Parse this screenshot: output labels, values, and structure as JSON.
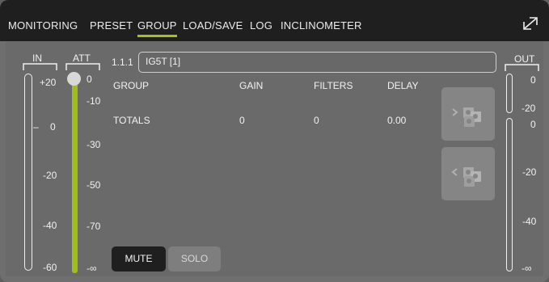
{
  "tabs": [
    "MONITORING",
    "PRESET",
    "GROUP",
    "LOAD/SAVE",
    "LOG",
    "INCLINOMETER"
  ],
  "active_tab": "GROUP",
  "meters": {
    "in_label": "IN",
    "att_label": "ATT",
    "out_label": "OUT",
    "in_scale": [
      "+20",
      "0",
      "-20",
      "-40",
      "-60"
    ],
    "att_scale": [
      "0",
      "-10",
      "-30",
      "-50",
      "-70",
      "-∞"
    ],
    "out_scale": [
      "0",
      "-20",
      "0",
      "-20",
      "-40",
      "-∞"
    ],
    "in_level_marker": "–"
  },
  "group": {
    "id": "1.1.1",
    "name": "IG5T [1]"
  },
  "table": {
    "headers": [
      "GROUP",
      "GAIN",
      "FILTERS",
      "DELAY"
    ],
    "rows": [
      [
        "TOTALS",
        "0",
        "0",
        "0.00"
      ]
    ]
  },
  "buttons": {
    "mute": "MUTE",
    "solo": "SOLO"
  },
  "colors": {
    "accent": "#a6c21a",
    "topbar": "#1f1f1f",
    "panel": "#6a6a6a"
  }
}
